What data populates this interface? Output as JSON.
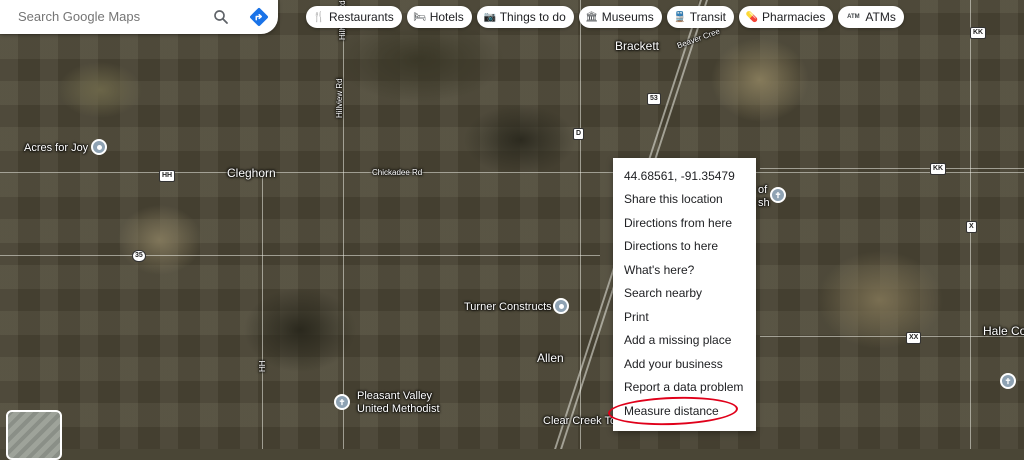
{
  "search": {
    "placeholder": "Search Google Maps",
    "search_icon": "search-icon",
    "directions_icon": "directions-icon"
  },
  "chips": [
    {
      "label": "Restaurants",
      "icon": "fork-knife-icon"
    },
    {
      "label": "Hotels",
      "icon": "bed-icon"
    },
    {
      "label": "Things to do",
      "icon": "camera-icon"
    },
    {
      "label": "Museums",
      "icon": "museum-icon"
    },
    {
      "label": "Transit",
      "icon": "train-icon"
    },
    {
      "label": "Pharmacies",
      "icon": "pill-icon"
    },
    {
      "label": "ATMs",
      "icon": "atm-icon"
    }
  ],
  "map": {
    "places": {
      "acres_for_joy": "Acres for Joy",
      "cleghorn": "Cleghorn",
      "brackett": "Brackett",
      "turner": "Turner Constructs",
      "allen": "Allen",
      "pleasant_valley_1": "Pleasant Valley",
      "pleasant_valley_2": "United Methodist",
      "clear_creek": "Clear Creek To",
      "hale_corner": "Hale Cor",
      "partial_of": "of",
      "partial_sh": "sh"
    },
    "roads": {
      "chickadee": "Chickadee Rd",
      "hillview": "Hillview Rd",
      "hillview_top": "Hillview Rd",
      "beaver": "Beaver Cree",
      "hh": "HH",
      "hh_2": "HH",
      "r35": "35",
      "r53": "53",
      "d": "D",
      "kk": "KK",
      "kk_2": "KK",
      "kk_3": "KK",
      "x": "X",
      "xx": "XX"
    }
  },
  "context_menu": {
    "coordinates": "44.68561, -91.35479",
    "items": [
      "Share this location",
      "Directions from here",
      "Directions to here",
      "What's here?",
      "Search nearby",
      "Print",
      "Add a missing place",
      "Add your business",
      "Report a data problem",
      "Measure distance"
    ],
    "highlight_color": "#e0001a"
  }
}
